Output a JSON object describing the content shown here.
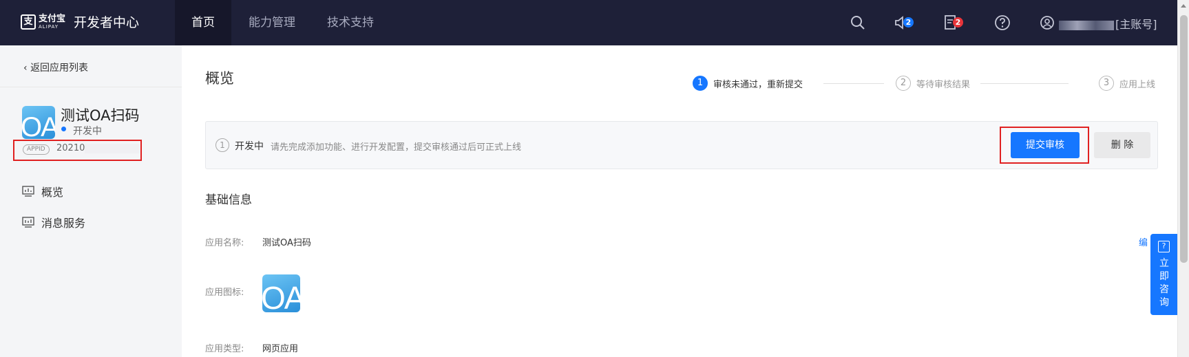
{
  "header": {
    "logo_cn": "支付宝",
    "logo_en": "ALIPAY",
    "title": "开发者中心",
    "tabs": [
      {
        "label": "首页"
      },
      {
        "label": "能力管理"
      },
      {
        "label": "技术支持"
      }
    ],
    "notifications_count": "2",
    "tasks_count": "2",
    "account_suffix": "[主账号]",
    "colors": {
      "bar": "#1e2038",
      "badge_blue": "#1677ff",
      "badge_red": "#e8343a"
    }
  },
  "sidebar": {
    "back_label": "返回应用列表",
    "app_name": "测试OA扫码",
    "app_icon_text": "OA",
    "status": "开发中",
    "appid_tag": "APPID",
    "appid_prefix": "20210",
    "menu": [
      {
        "label": "概览",
        "icon": "dashboard-icon"
      },
      {
        "label": "消息服务",
        "icon": "message-service-icon"
      }
    ]
  },
  "main": {
    "page_title": "概览",
    "steps": [
      {
        "num": "1",
        "label": "审核未通过，重新提交"
      },
      {
        "num": "2",
        "label": "等待审核结果"
      },
      {
        "num": "3",
        "label": "应用上线"
      }
    ],
    "notice": {
      "num": "1",
      "status": "开发中",
      "text": "请先完成添加功能、进行开发配置，提交审核通过后可正式上线",
      "submit_label": "提交审核",
      "delete_label": "删 除"
    },
    "section_title": "基础信息",
    "fields": {
      "name_label": "应用名称:",
      "name_value": "测试OA扫码",
      "icon_label": "应用图标:",
      "type_label": "应用类型:",
      "type_value": "网页应用"
    },
    "edit_label": "编",
    "consult_label": "立即咨询",
    "consult_icon_char": "?"
  }
}
